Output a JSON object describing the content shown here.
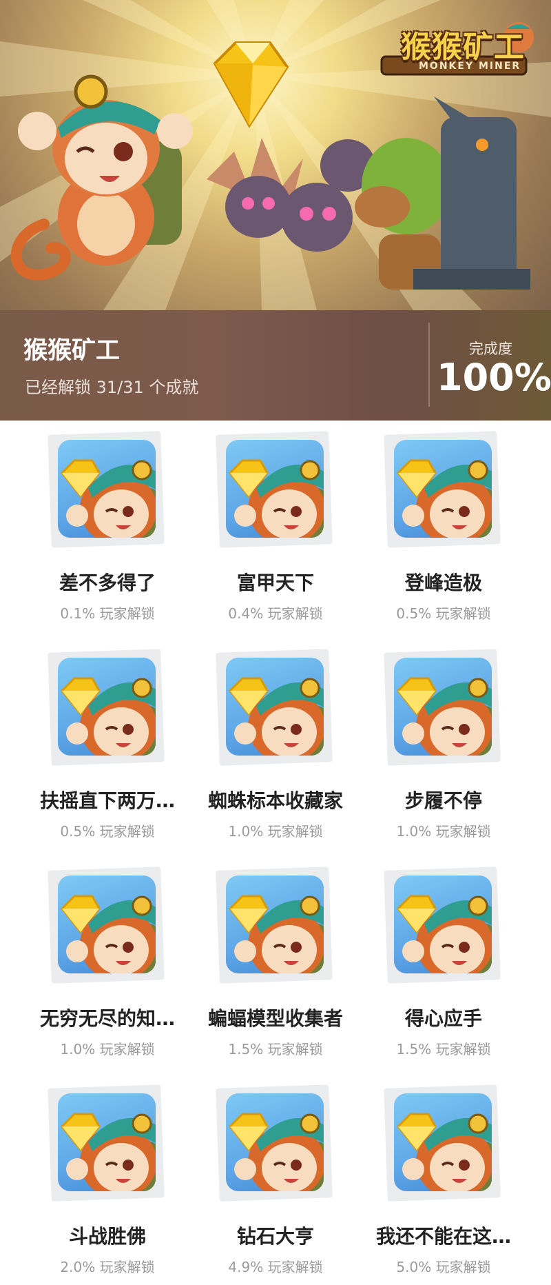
{
  "game": {
    "title": "猴猴矿工",
    "unlocked_text": "已经解锁 31/31 个成就",
    "completion_label": "完成度",
    "completion_value": "100%",
    "logo_title": "猴猴矿工",
    "logo_subtitle": "MONKEY MINER"
  },
  "achievements": [
    {
      "name": "差不多得了",
      "rate": "0.1% 玩家解锁"
    },
    {
      "name": "富甲天下",
      "rate": "0.4% 玩家解锁"
    },
    {
      "name": "登峰造极",
      "rate": "0.5% 玩家解锁"
    },
    {
      "name": "扶摇直下两万…",
      "rate": "0.5% 玩家解锁"
    },
    {
      "name": "蜘蛛标本收藏家",
      "rate": "1.0% 玩家解锁"
    },
    {
      "name": "步履不停",
      "rate": "1.0% 玩家解锁"
    },
    {
      "name": "无穷无尽的知…",
      "rate": "1.0% 玩家解锁"
    },
    {
      "name": "蝙蝠模型收集者",
      "rate": "1.5% 玩家解锁"
    },
    {
      "name": "得心应手",
      "rate": "1.5% 玩家解锁"
    },
    {
      "name": "斗战胜佛",
      "rate": "2.0% 玩家解锁"
    },
    {
      "name": "钻石大亨",
      "rate": "4.9% 玩家解锁"
    },
    {
      "name": "我还不能在这…",
      "rate": "5.0% 玩家解锁"
    }
  ]
}
